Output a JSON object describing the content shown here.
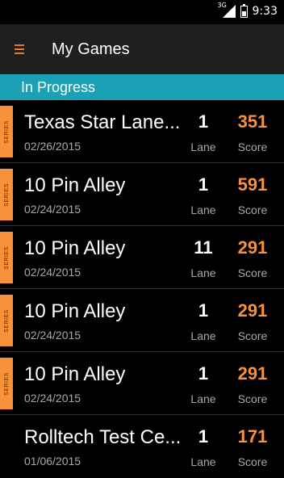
{
  "status_bar": {
    "network": "3G",
    "time": "9:33",
    "icons": [
      "signal-icon",
      "battery-icon"
    ]
  },
  "app_bar": {
    "menu_icon": "menu-icon",
    "title": "My Games"
  },
  "section": {
    "title": "In Progress"
  },
  "colors": {
    "accent": "#f7923a",
    "section_bg": "#1ba1b6",
    "app_bar_bg": "#1f1f1f"
  },
  "games": [
    {
      "series_tag": "SERIES",
      "name": "Texas Star Lane...",
      "date": "02/26/2015",
      "lane": "1",
      "lane_label": "Lane",
      "score": "351",
      "score_label": "Score"
    },
    {
      "series_tag": "SERIES",
      "name": "10 Pin Alley",
      "date": "02/24/2015",
      "lane": "1",
      "lane_label": "Lane",
      "score": "591",
      "score_label": "Score"
    },
    {
      "series_tag": "SERIES",
      "name": "10 Pin Alley",
      "date": "02/24/2015",
      "lane": "11",
      "lane_label": "Lane",
      "score": "291",
      "score_label": "Score"
    },
    {
      "series_tag": "SERIES",
      "name": "10 Pin Alley",
      "date": "02/24/2015",
      "lane": "1",
      "lane_label": "Lane",
      "score": "291",
      "score_label": "Score"
    },
    {
      "series_tag": "SERIES",
      "name": "10 Pin Alley",
      "date": "02/24/2015",
      "lane": "1",
      "lane_label": "Lane",
      "score": "291",
      "score_label": "Score"
    },
    {
      "series_tag": "",
      "name": "Rolltech Test Ce...",
      "date": "01/06/2015",
      "lane": "1",
      "lane_label": "Lane",
      "score": "171",
      "score_label": "Score"
    }
  ]
}
